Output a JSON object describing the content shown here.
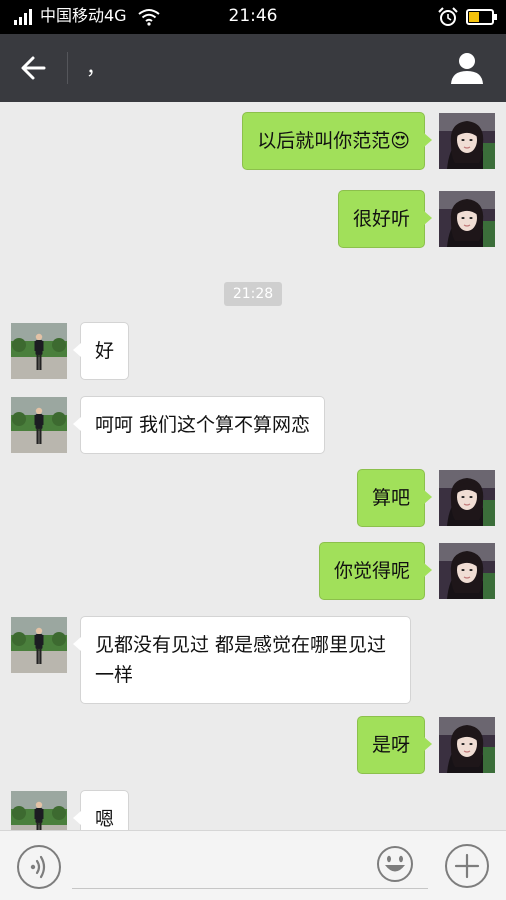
{
  "status_bar": {
    "carrier": "中国移动4G",
    "time": "21:46",
    "icons": [
      "signal-icon",
      "wifi-icon",
      "alarm-icon",
      "battery-charging-icon"
    ]
  },
  "header": {
    "title": "，",
    "icons": [
      "back-arrow-icon",
      "profile-icon"
    ]
  },
  "chat": {
    "timestamp": "21:28",
    "messages": [
      {
        "sender": "me",
        "text": "以后就叫你范范😍"
      },
      {
        "sender": "me",
        "text": "很好听"
      },
      {
        "sender": "other",
        "text": "好"
      },
      {
        "sender": "other",
        "text": "呵呵 我们这个算不算网恋"
      },
      {
        "sender": "me",
        "text": "算吧"
      },
      {
        "sender": "me",
        "text": "你觉得呢"
      },
      {
        "sender": "other",
        "text": "见都没有见过 都是感觉在哪里见过一样"
      },
      {
        "sender": "me",
        "text": "是呀"
      },
      {
        "sender": "other",
        "text": "嗯"
      }
    ]
  },
  "input_bar": {
    "value": "",
    "icons": [
      "voice-icon",
      "emoji-icon",
      "plus-icon"
    ]
  },
  "colors": {
    "header_bg": "#393a3f",
    "chat_bg": "#ebebeb",
    "my_bubble": "#a1e05a",
    "other_bubble": "#ffffff"
  }
}
